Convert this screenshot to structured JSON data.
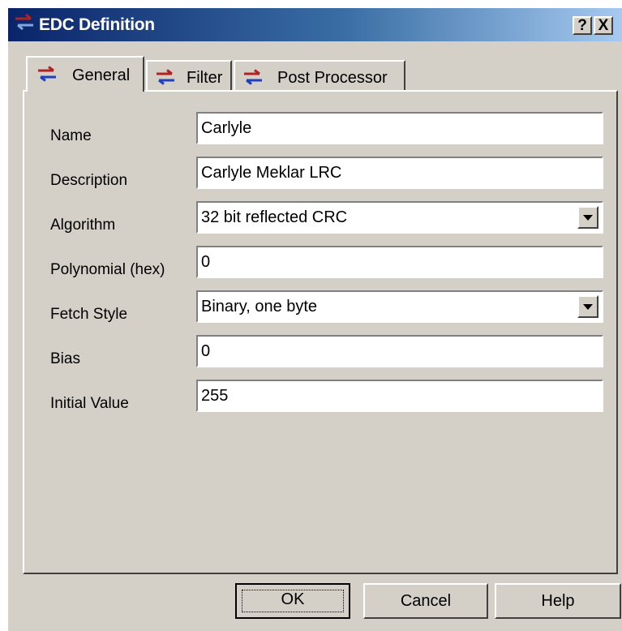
{
  "window": {
    "title": "EDC Definition",
    "help_button": "?",
    "close_button": "X"
  },
  "tabs": [
    {
      "label": "General",
      "selected": true
    },
    {
      "label": "Filter",
      "selected": false
    },
    {
      "label": "Post Processor",
      "selected": false
    }
  ],
  "form": {
    "name": {
      "label": "Name",
      "value": "Carlyle"
    },
    "description": {
      "label": "Description",
      "value": "Carlyle Meklar LRC"
    },
    "algorithm": {
      "label": "Algorithm",
      "value": "32 bit reflected CRC"
    },
    "polynomial": {
      "label": "Polynomial (hex)",
      "value": "0"
    },
    "fetch_style": {
      "label": "Fetch Style",
      "value": "Binary, one byte"
    },
    "bias": {
      "label": "Bias",
      "value": "0"
    },
    "initial_value": {
      "label": "Initial Value",
      "value": "255"
    }
  },
  "buttons": {
    "ok": "OK",
    "cancel": "Cancel",
    "help": "Help"
  },
  "colors": {
    "titlebar_start": "#0a246a",
    "titlebar_end": "#a6caf0",
    "dialog_face": "#d4d0c8",
    "tab_icon_red": "#b22222",
    "tab_icon_blue": "#1f3fbf"
  },
  "icons": {
    "title": "transfer-arrows-icon",
    "tab": "transfer-arrows-icon",
    "dropdown": "chevron-down-icon"
  }
}
